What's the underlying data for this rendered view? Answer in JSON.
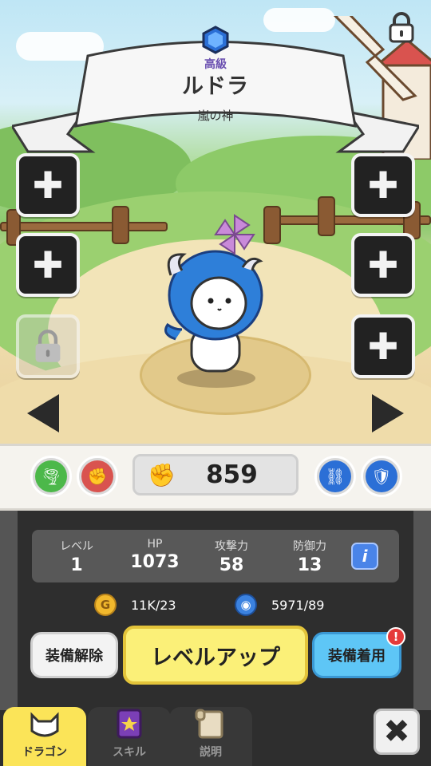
{
  "character": {
    "rank": "高級",
    "name": "ルドラ",
    "title": "嵐の神"
  },
  "power": {
    "value": "859"
  },
  "stats": {
    "level": {
      "label": "レベル",
      "value": "1"
    },
    "hp": {
      "label": "HP",
      "value": "1073"
    },
    "attack": {
      "label": "攻撃力",
      "value": "58"
    },
    "defense": {
      "label": "防御力",
      "value": "13"
    }
  },
  "resources": {
    "gold": "11K/23",
    "soul": "5971/89"
  },
  "buttons": {
    "unequip": "装備解除",
    "level_up": "レベルアップ",
    "equip": "装備着用",
    "equip_badge": "!"
  },
  "tabs": [
    {
      "label": "ドラゴン"
    },
    {
      "label": "スキル"
    },
    {
      "label": "説明"
    }
  ],
  "colors": {
    "level_up_bg": "#fbf078",
    "equip_bg": "#5ec6f6",
    "active_tab": "#fbe458"
  }
}
